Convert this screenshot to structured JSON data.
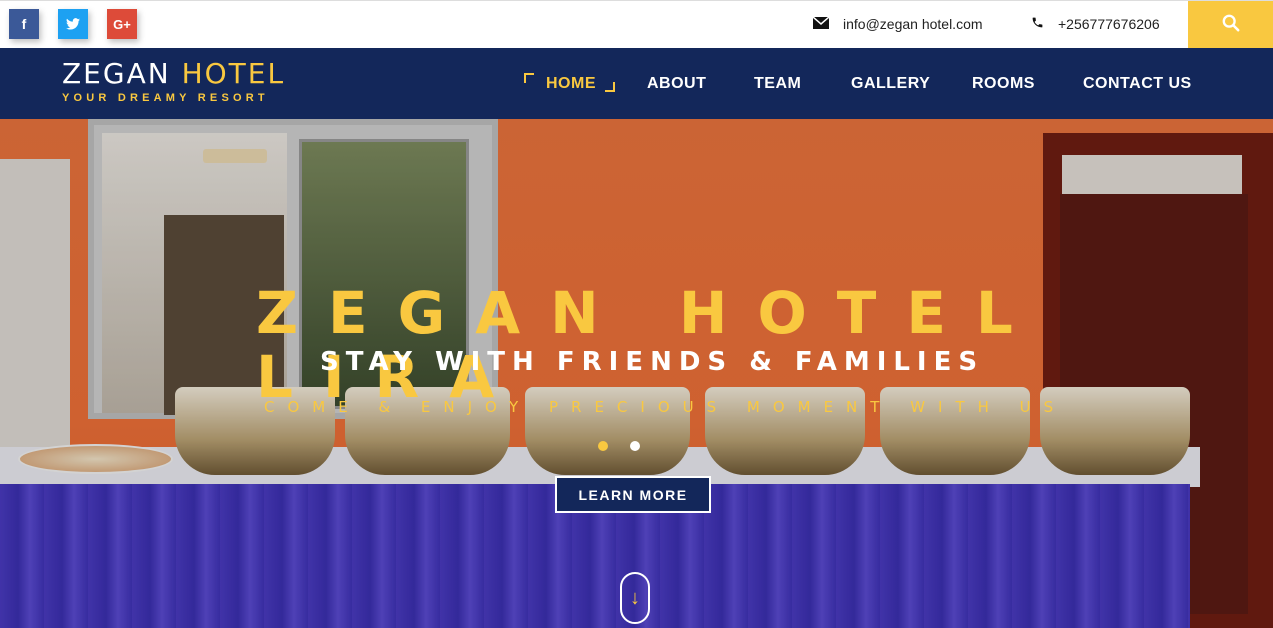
{
  "topbar": {
    "social": [
      {
        "name": "facebook",
        "glyph": "f"
      },
      {
        "name": "twitter",
        "glyph": "t"
      },
      {
        "name": "google-plus",
        "glyph": "G+"
      }
    ],
    "email": "info@zegan hotel.com",
    "phone": "+256777676206",
    "icons": {
      "email": "envelope-icon",
      "phone": "phone-icon",
      "search": "search-icon"
    }
  },
  "logo": {
    "title_main": "ZEGAN ",
    "title_accent": "HOTEL",
    "tagline": "YOUR DREAMY RESORT"
  },
  "nav": {
    "items": [
      {
        "label": "HOME",
        "active": true
      },
      {
        "label": "ABOUT"
      },
      {
        "label": "TEAM"
      },
      {
        "label": "GALLERY"
      },
      {
        "label": "ROOMS"
      },
      {
        "label": "CONTACT US"
      }
    ]
  },
  "hero": {
    "title": "ZEGAN HOTEL LIRA",
    "subtitle": "STAY WITH FRIENDS & FAMILIES",
    "tagline": "COME & ENJOY PRECIOUS MOMENT WITH US",
    "button_label": "LEARN MORE",
    "scroll_glyph": "↓",
    "slide_count": 2,
    "active_slide": 1
  },
  "colors": {
    "navy": "#13275a",
    "accent": "#f9c840",
    "facebook": "#3b5998",
    "twitter": "#1da1f2",
    "google_plus": "#dd4b39"
  }
}
